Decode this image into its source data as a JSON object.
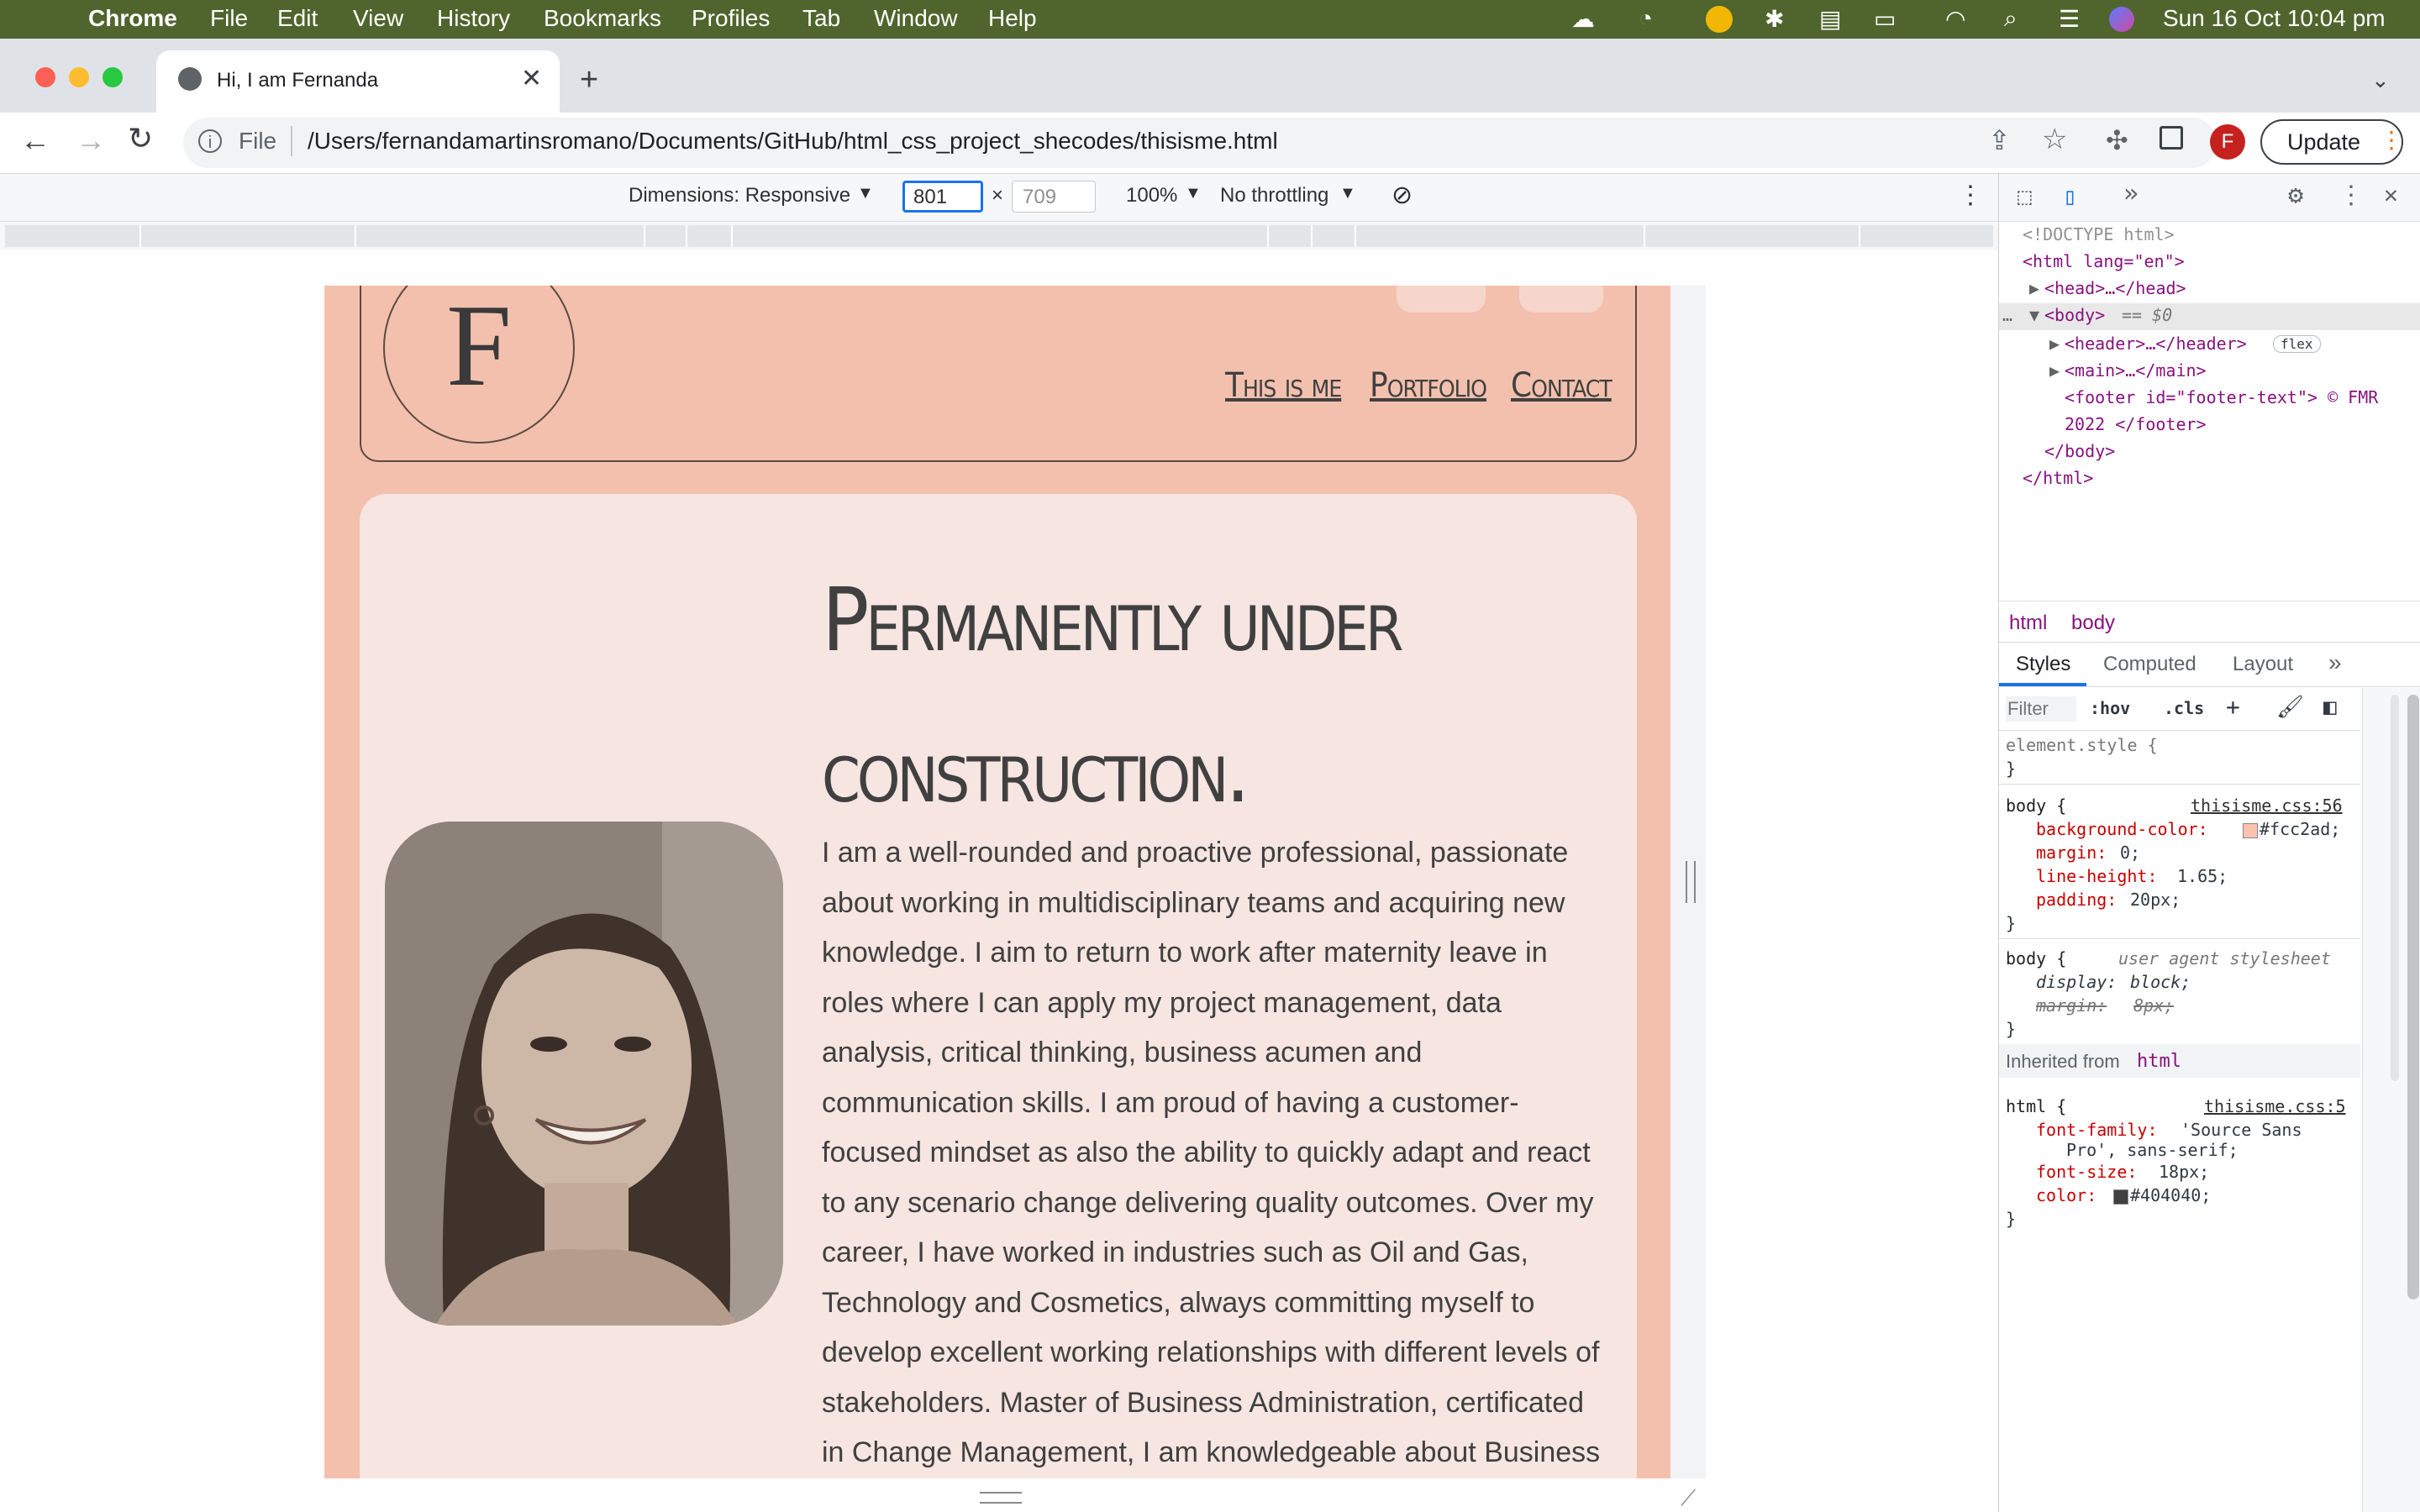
{
  "menubar": {
    "app": "Chrome",
    "items": [
      "File",
      "Edit",
      "View",
      "History",
      "Bookmarks",
      "Profiles",
      "Tab",
      "Window",
      "Help"
    ],
    "clock": "Sun 16 Oct  10:04 pm"
  },
  "browser": {
    "tab_title": "Hi, I am Fernanda",
    "file_label": "File",
    "url": "/Users/fernandamartinsromano/Documents/GitHub/html_css_project_shecodes/thisisme.html",
    "update_label": "Update",
    "avatar_letter": "F"
  },
  "device_toolbar": {
    "dimensions": "Dimensions: Responsive",
    "width": "801",
    "times": "×",
    "height": "709",
    "zoom": "100%",
    "throttle": "No throttling"
  },
  "page": {
    "logo_letter": "F",
    "nav": [
      "This is me",
      "Portfolio",
      "Contact"
    ],
    "title_line1": "Permanently under",
    "title_line2": "construction.",
    "bio": "I am a well-rounded and proactive professional, passionate about working in multidisciplinary teams and acquiring new knowledge. I aim to return to work after maternity leave in roles where I can apply my project management, data analysis, critical thinking, business acumen and communication skills. I am proud of having a customer-focused mindset as also the ability to quickly adapt and react to any scenario change delivering quality outcomes. Over my career, I have worked in industries such as Oil and Gas, Technology and Cosmetics, always committing myself to develop excellent working relationships with different levels of stakeholders. Master of Business Administration, certificated in Change Management, I am knowledgeable about Business Analysis and Agile mindset."
  },
  "devtools": {
    "dom": {
      "doctype": "<!DOCTYPE html>",
      "html_open": "<html lang=\"en\">",
      "head": "<head>…</head>",
      "body": "<body>",
      "body_eq": "== $0",
      "header": "<header>…</header>",
      "flex_badge": "flex",
      "main": "<main>…</main>",
      "footer_line1": "<footer id=\"footer-text\"> © FMR",
      "footer_line2": "2022 </footer>",
      "body_close": "</body>",
      "html_close": "</html>"
    },
    "breadcrumbs": [
      "html",
      "body"
    ],
    "tabs": [
      "Styles",
      "Computed",
      "Layout"
    ],
    "filter_placeholder": "Filter",
    "hov": ":hov",
    "cls": ".cls",
    "rules": {
      "element_style": "element.style {",
      "close": "}",
      "body_sel": "body {",
      "body_src": "thisisme.css:56",
      "p1": "background-color:",
      "v1": "#fcc2ad;",
      "p2": "margin:",
      "v2": "0;",
      "p3": "line-height:",
      "v3": "1.65;",
      "p4": "padding:",
      "v4": "20px;",
      "ua_sel": "body {",
      "ua_src": "user agent stylesheet",
      "p5": "display:",
      "v5": "block;",
      "p6": "margin:",
      "v6": "8px;",
      "inherited": "Inherited from",
      "inherited_el": "html",
      "html_sel": "html {",
      "html_src": "thisisme.css:5",
      "p7": "font-family:",
      "v7a": "'Source Sans",
      "v7b": "Pro', sans-serif;",
      "p8": "font-size:",
      "v8": "18px;",
      "p9": "color:",
      "v9": "#404040;"
    }
  },
  "colors": {
    "page_bg": "#fcc2ad",
    "card_bg": "#f6e5e0",
    "text": "#404040",
    "menubar": "#4f652d"
  }
}
